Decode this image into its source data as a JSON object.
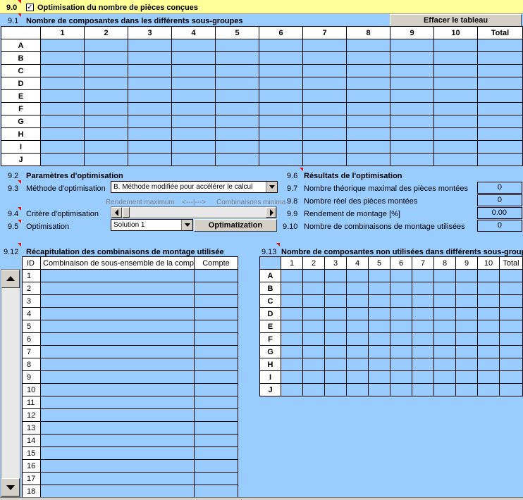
{
  "section90": {
    "num": "9.0",
    "title": "Optimisation du nombre de pièces conçues",
    "checkbox_mark": "✓"
  },
  "section91": {
    "num": "9.1",
    "title": "Nombre de composantes dans les différents sous-groupes",
    "clear_button": "Effacer le tableau"
  },
  "main_grid": {
    "columns": [
      "1",
      "2",
      "3",
      "4",
      "5",
      "6",
      "7",
      "8",
      "9",
      "10",
      "Total"
    ],
    "rows": [
      "A",
      "B",
      "C",
      "D",
      "E",
      "F",
      "G",
      "H",
      "I",
      "J"
    ]
  },
  "params": {
    "n92": "9.2",
    "title": "Paramètres d'optimisation",
    "n93": "9.3",
    "method_label": "Méthode d'optimisation",
    "method_value": "B. Méthode modifiée pour accélérer le calcul",
    "slider_left": "Rendement maximum",
    "slider_mid": "<---|--->",
    "slider_right": "Combinaisons minima",
    "n94": "9.4",
    "criterion_label": "Critère d'optimisation",
    "n95": "9.5",
    "opt_label": "Optimisation",
    "opt_value": "Solution 1",
    "opt_button": "Optimatization"
  },
  "results": {
    "n96": "9.6",
    "title": "Résultats de l'optimisation",
    "n97": "9.7",
    "r1_label": "Nombre théorique maximal des pièces montées",
    "r1_value": "0",
    "n98": "9.8",
    "r2_label": "Nombre réel des pièces montées",
    "r2_value": "0",
    "n99": "9.9",
    "r3_label": "Rendement de montage [%]",
    "r3_value": "0.00",
    "n910": "9.10",
    "r4_label": "Nombre de combinaisons de montage utilisées",
    "r4_value": "0"
  },
  "recap": {
    "n912": "9.12",
    "title": "Récapitulation des combinaisons de montage utilisée",
    "col_id": "ID",
    "col_combo": "Combinaison de sous-ensemble de la composante",
    "col_count": "Compte",
    "ids": [
      "1",
      "2",
      "3",
      "4",
      "5",
      "6",
      "7",
      "8",
      "9",
      "10",
      "11",
      "12",
      "13",
      "14",
      "15",
      "16",
      "17",
      "18"
    ]
  },
  "unused": {
    "n913": "9.13",
    "title": "Nombre de composantes non utilisées dans différents sous-groupes",
    "columns": [
      "1",
      "2",
      "3",
      "4",
      "5",
      "6",
      "7",
      "8",
      "9",
      "10",
      "Total"
    ],
    "rows": [
      "A",
      "B",
      "C",
      "D",
      "E",
      "F",
      "G",
      "H",
      "I",
      "J"
    ]
  }
}
